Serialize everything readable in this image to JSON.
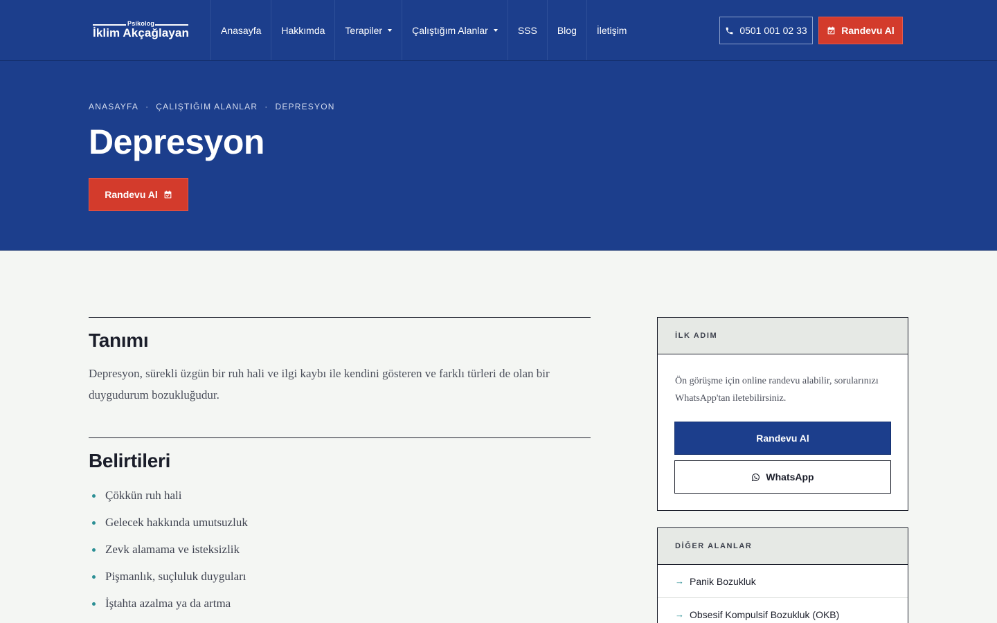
{
  "header": {
    "logo": {
      "subtitle": "Psikolog",
      "name": "İklim Akçağlayan"
    },
    "nav": [
      {
        "label": "Anasayfa",
        "dropdown": false
      },
      {
        "label": "Hakkımda",
        "dropdown": false
      },
      {
        "label": "Terapiler",
        "dropdown": true
      },
      {
        "label": "Çalıştığım Alanlar",
        "dropdown": true
      },
      {
        "label": "SSS",
        "dropdown": false
      },
      {
        "label": "Blog",
        "dropdown": false
      },
      {
        "label": "İletişim",
        "dropdown": false
      }
    ],
    "phone": "0501 001 02 33",
    "cta_label": "Randevu Al"
  },
  "hero": {
    "breadcrumb": [
      "ANASAYFA",
      "ÇALIŞTIĞIM ALANLAR",
      "DEPRESYON"
    ],
    "breadcrumb_separator": "·",
    "title": "Depresyon",
    "cta_label": "Randevu Al"
  },
  "main": {
    "definition": {
      "title": "Tanımı",
      "text": "Depresyon, sürekli üzgün bir ruh hali ve ilgi kaybı ile kendini gösteren ve farklı türleri de olan bir duygudurum bozukluğudur."
    },
    "symptoms": {
      "title": "Belirtileri",
      "items": [
        "Çökkün ruh hali",
        "Gelecek hakkında umutsuzluk",
        "Zevk alamama ve isteksizlik",
        "Pişmanlık, suçluluk duyguları",
        "İştahta azalma ya da artma"
      ]
    }
  },
  "sidebar": {
    "first_step": {
      "heading": "İLK ADIM",
      "text": "Ön görüşme için online randevu alabilir, sorularınızı WhatsApp'tan iletebilirsiniz.",
      "primary_label": "Randevu Al",
      "whatsapp_label": "WhatsApp"
    },
    "other_areas": {
      "heading": "DİĞER ALANLAR",
      "items": [
        "Panik Bozukluk",
        "Obsesif Kompulsif Bozukluk (OKB)"
      ]
    }
  },
  "colors": {
    "brand_blue": "#1c3e8c",
    "accent_red": "#d33b2c",
    "teal": "#2b8f94",
    "background": "#f4f6f3"
  }
}
